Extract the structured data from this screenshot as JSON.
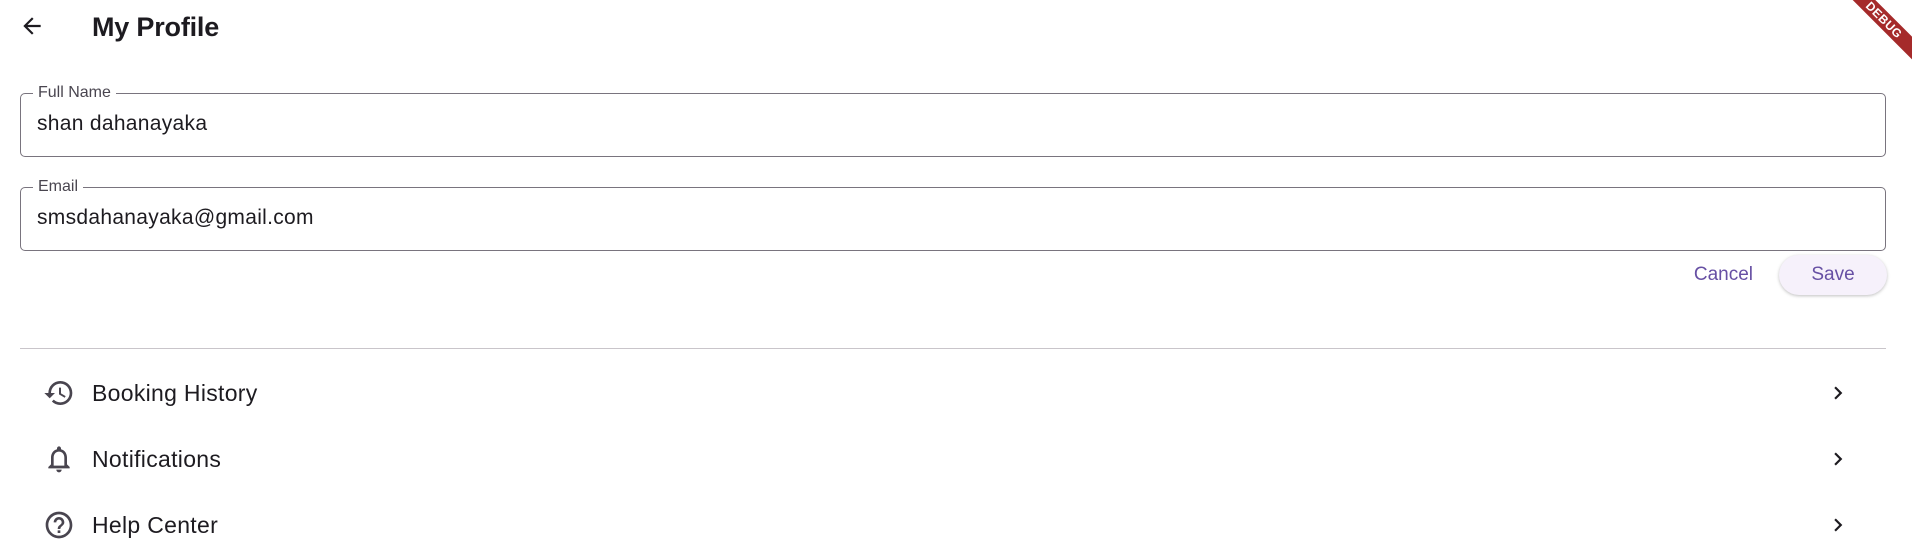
{
  "appbar": {
    "title": "My Profile",
    "back_icon": "arrow-back-icon"
  },
  "debug_banner": {
    "label": "DEBUG",
    "color": "#a52a2a"
  },
  "form": {
    "full_name": {
      "label": "Full Name",
      "value": "shan dahanayaka"
    },
    "email": {
      "label": "Email",
      "value": "smsdahanayaka@gmail.com"
    }
  },
  "actions": {
    "cancel_label": "Cancel",
    "save_label": "Save",
    "accent_color": "#6750a4"
  },
  "menu": {
    "items": [
      {
        "label": "Booking History",
        "icon": "history-icon",
        "trailing_icon": "chevron-right-icon"
      },
      {
        "label": "Notifications",
        "icon": "bell-icon",
        "trailing_icon": "chevron-right-icon"
      },
      {
        "label": "Help Center",
        "icon": "help-circle-icon",
        "trailing_icon": "chevron-right-icon"
      }
    ]
  }
}
